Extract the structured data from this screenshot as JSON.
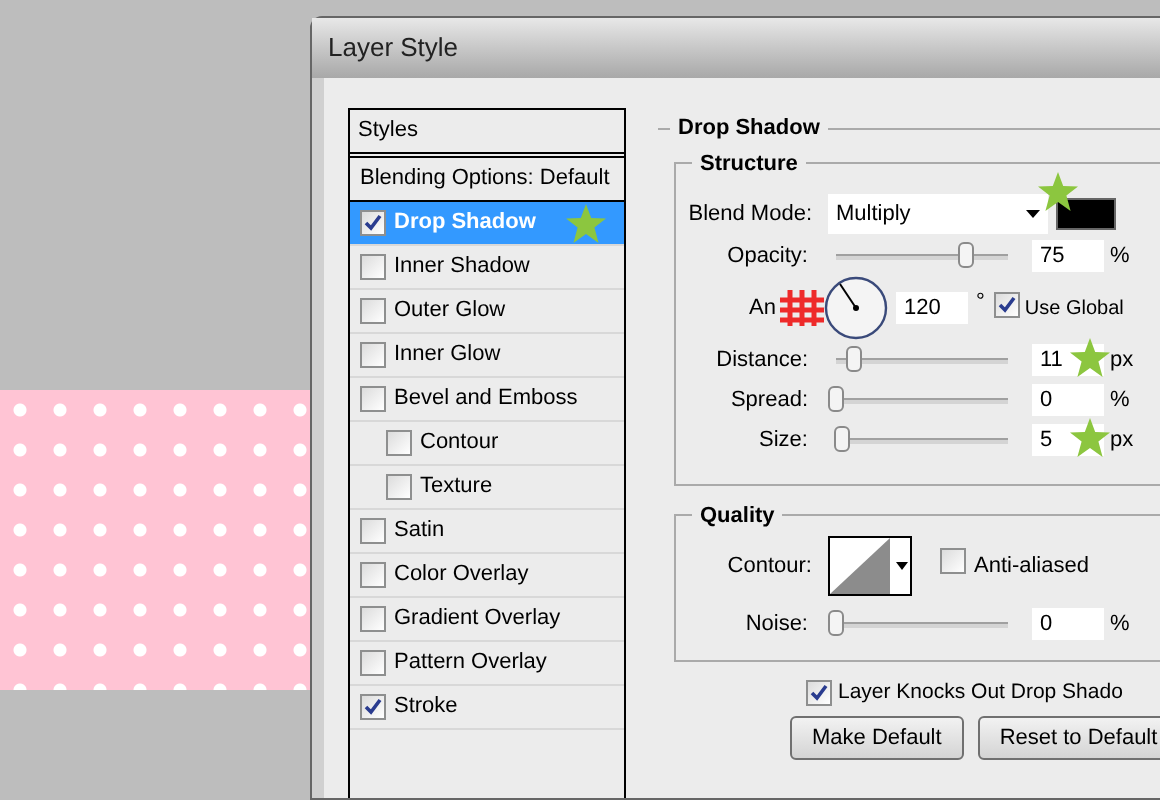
{
  "window": {
    "title": "Layer Style"
  },
  "styles_panel": {
    "header": "Styles",
    "items": [
      {
        "label": "Blending Options: Default",
        "kind": "plain",
        "selected": false
      },
      {
        "label": "Drop Shadow",
        "kind": "check",
        "checked": true,
        "selected": true
      },
      {
        "label": "Inner Shadow",
        "kind": "check",
        "checked": false,
        "selected": false
      },
      {
        "label": "Outer Glow",
        "kind": "check",
        "checked": false,
        "selected": false
      },
      {
        "label": "Inner Glow",
        "kind": "check",
        "checked": false,
        "selected": false
      },
      {
        "label": "Bevel and Emboss",
        "kind": "check",
        "checked": false,
        "selected": false,
        "children": [
          {
            "label": "Contour",
            "kind": "check",
            "checked": false,
            "selected": false
          },
          {
            "label": "Texture",
            "kind": "check",
            "checked": false,
            "selected": false
          }
        ]
      },
      {
        "label": "Satin",
        "kind": "check",
        "checked": false,
        "selected": false
      },
      {
        "label": "Color Overlay",
        "kind": "check",
        "checked": false,
        "selected": false
      },
      {
        "label": "Gradient Overlay",
        "kind": "check",
        "checked": false,
        "selected": false
      },
      {
        "label": "Pattern Overlay",
        "kind": "check",
        "checked": false,
        "selected": false
      },
      {
        "label": "Stroke",
        "kind": "check",
        "checked": true,
        "selected": false
      }
    ]
  },
  "drop_shadow": {
    "title": "Drop Shadow",
    "structure": {
      "title": "Structure",
      "blend_mode": {
        "label": "Blend Mode:",
        "value": "Multiply"
      },
      "opacity": {
        "label": "Opacity:",
        "level": 0.75,
        "value": "75",
        "unit": "%"
      },
      "angle": {
        "label": "An",
        "value": "120",
        "unit": "°",
        "use_global": {
          "label": "Use Global",
          "checked": true
        }
      },
      "sliders": [
        {
          "label": "Distance:",
          "level": 0.1,
          "value": "11",
          "unit": "px"
        },
        {
          "label": "Spread:",
          "level": 0,
          "value": "0",
          "unit": "%"
        },
        {
          "label": "Size:",
          "level": 0.03,
          "value": "5",
          "unit": "px"
        }
      ]
    },
    "quality": {
      "title": "Quality",
      "contour_label": "Contour:",
      "anti_aliased": {
        "label": "Anti-aliased",
        "checked": false
      },
      "noise": {
        "label": "Noise:",
        "level": 0,
        "value": "0",
        "unit": "%"
      }
    },
    "knocks_out": {
      "label": "Layer Knocks Out Drop Shado",
      "checked": true
    },
    "buttons": [
      "Make Default",
      "Reset to Default"
    ]
  }
}
